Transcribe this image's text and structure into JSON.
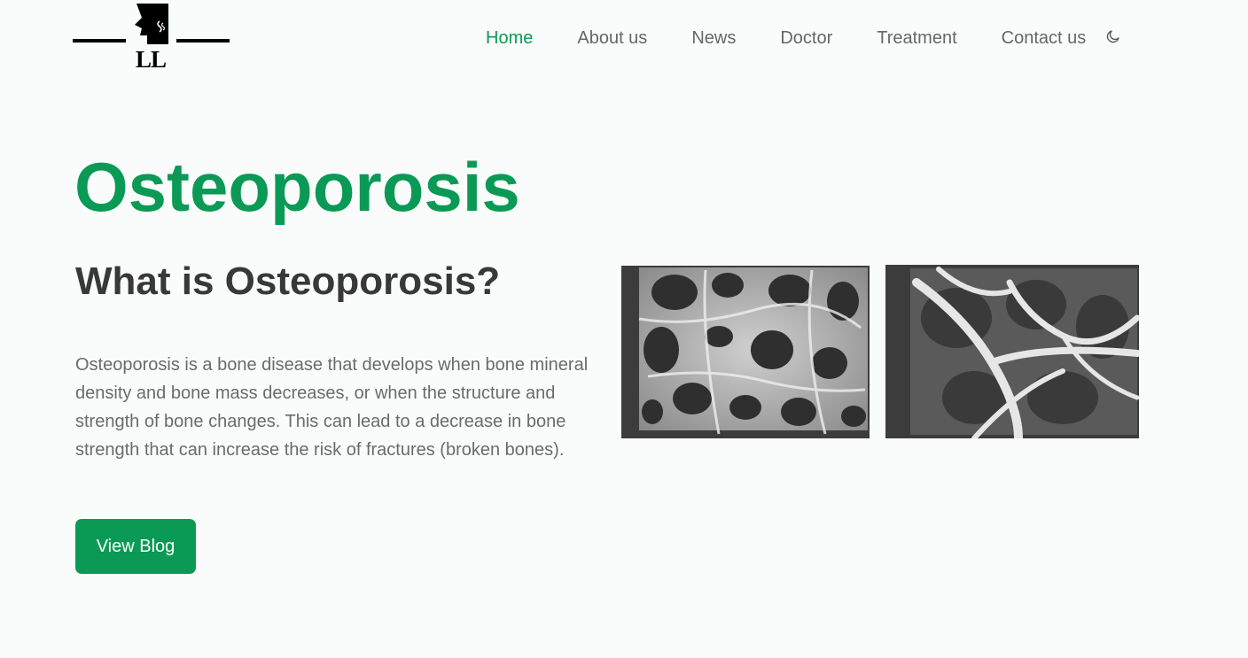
{
  "header": {
    "logo_text": "LL",
    "nav": [
      {
        "label": "Home",
        "active": true
      },
      {
        "label": "About us",
        "active": false
      },
      {
        "label": "News",
        "active": false
      },
      {
        "label": "Doctor",
        "active": false
      },
      {
        "label": "Treatment",
        "active": false
      },
      {
        "label": "Contact us",
        "active": false
      }
    ],
    "theme_toggle_icon": "moon-icon"
  },
  "hero": {
    "title": "Osteoporosis",
    "subtitle": "What is Osteoporosis?",
    "description": "Osteoporosis is a bone disease that develops when bone mineral density and bone mass decreases, or when the structure and strength of bone changes. This can lead to a decrease in bone strength that can increase the risk of fractures (broken bones).",
    "cta_label": "View Blog"
  },
  "images": [
    {
      "name": "normal-bone-micrograph"
    },
    {
      "name": "osteoporotic-bone-micrograph"
    }
  ],
  "colors": {
    "accent": "#0a9a55",
    "background": "#f9fcfb",
    "heading": "#383838",
    "body_text": "#6b6b6b",
    "nav_text": "#666666"
  }
}
